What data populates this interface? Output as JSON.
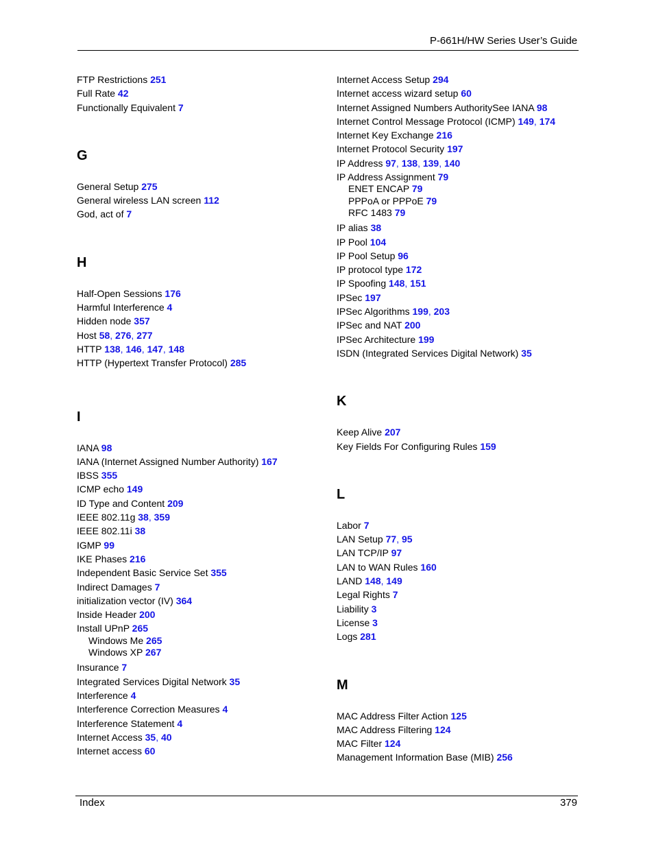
{
  "header": {
    "title": "P-661H/HW Series User’s Guide"
  },
  "footer": {
    "section": "Index",
    "page_number": "379"
  },
  "colors": {
    "link": "#1414e6",
    "text": "#000000"
  },
  "left_column": {
    "f_entries": [
      {
        "term": "FTP Restrictions",
        "pages": [
          "251"
        ]
      },
      {
        "term": "Full Rate",
        "pages": [
          "42"
        ]
      },
      {
        "term": "Functionally Equivalent",
        "pages": [
          "7"
        ]
      }
    ],
    "g": {
      "letter": "G",
      "entries": [
        {
          "term": "General Setup",
          "pages": [
            "275"
          ]
        },
        {
          "term": "General wireless LAN screen",
          "pages": [
            "112"
          ]
        },
        {
          "term": "God, act of",
          "pages": [
            "7"
          ]
        }
      ]
    },
    "h": {
      "letter": "H",
      "entries": [
        {
          "term": "Half-Open Sessions",
          "pages": [
            "176"
          ]
        },
        {
          "term": "Harmful Interference",
          "pages": [
            "4"
          ]
        },
        {
          "term": "Hidden node",
          "pages": [
            "357"
          ]
        },
        {
          "term": "Host",
          "pages": [
            "58",
            "276",
            "277"
          ]
        },
        {
          "term": "HTTP",
          "pages": [
            "138",
            "146",
            "147",
            "148"
          ]
        },
        {
          "term": "HTTP (Hypertext Transfer Protocol)",
          "pages": [
            "285"
          ]
        }
      ]
    },
    "i": {
      "letter": "I",
      "entries": [
        {
          "term": "IANA",
          "pages": [
            "98"
          ]
        },
        {
          "term": "IANA (Internet Assigned Number Authority)",
          "pages": [
            "167"
          ]
        },
        {
          "term": "IBSS",
          "pages": [
            "355"
          ]
        },
        {
          "term": "ICMP echo",
          "pages": [
            "149"
          ]
        },
        {
          "term": "ID Type and Content",
          "pages": [
            "209"
          ]
        },
        {
          "term": "IEEE 802.11g",
          "pages": [
            "38",
            "359"
          ]
        },
        {
          "term": "IEEE 802.11i",
          "pages": [
            "38"
          ]
        },
        {
          "term": "IGMP",
          "pages": [
            "99"
          ]
        },
        {
          "term": "IKE Phases",
          "pages": [
            "216"
          ]
        },
        {
          "term": "Independent Basic Service Set",
          "pages": [
            "355"
          ]
        },
        {
          "term": "Indirect Damages",
          "pages": [
            "7"
          ]
        },
        {
          "term": "initialization vector (IV)",
          "pages": [
            "364"
          ]
        },
        {
          "term": "Inside Header",
          "pages": [
            "200"
          ]
        },
        {
          "term": "Install UPnP",
          "pages": [
            "265"
          ],
          "sub": [
            {
              "term": "Windows Me",
              "pages": [
                "265"
              ]
            },
            {
              "term": "Windows XP",
              "pages": [
                "267"
              ]
            }
          ]
        },
        {
          "term": "Insurance",
          "pages": [
            "7"
          ]
        },
        {
          "term": "Integrated Services Digital Network",
          "pages": [
            "35"
          ]
        },
        {
          "term": "Interference",
          "pages": [
            "4"
          ]
        },
        {
          "term": "Interference Correction Measures",
          "pages": [
            "4"
          ]
        },
        {
          "term": "Interference Statement",
          "pages": [
            "4"
          ]
        },
        {
          "term": "Internet Access",
          "pages": [
            "35",
            "40"
          ]
        },
        {
          "term": "Internet access",
          "pages": [
            "60"
          ]
        }
      ]
    }
  },
  "right_column": {
    "i_entries": [
      {
        "term": "Internet Access Setup",
        "pages": [
          "294"
        ]
      },
      {
        "term": "Internet access wizard setup",
        "pages": [
          "60"
        ]
      },
      {
        "term": "Internet Assigned Numbers AuthoritySee IANA",
        "pages": [
          "98"
        ]
      },
      {
        "term": "Internet Control Message Protocol (ICMP)",
        "pages": [
          "149",
          "174"
        ]
      },
      {
        "term": "Internet Key Exchange",
        "pages": [
          "216"
        ]
      },
      {
        "term": "Internet Protocol Security",
        "pages": [
          "197"
        ]
      },
      {
        "term": "IP Address",
        "pages": [
          "97",
          "138",
          "139",
          "140"
        ]
      },
      {
        "term": "IP Address Assignment",
        "pages": [
          "79"
        ],
        "sub": [
          {
            "term": "ENET ENCAP",
            "pages": [
              "79"
            ]
          },
          {
            "term": "PPPoA or PPPoE",
            "pages": [
              "79"
            ]
          },
          {
            "term": "RFC 1483",
            "pages": [
              "79"
            ]
          }
        ]
      },
      {
        "term": "IP alias",
        "pages": [
          "38"
        ]
      },
      {
        "term": "IP Pool",
        "pages": [
          "104"
        ]
      },
      {
        "term": "IP Pool Setup",
        "pages": [
          "96"
        ]
      },
      {
        "term": "IP protocol type",
        "pages": [
          "172"
        ]
      },
      {
        "term": "IP Spoofing",
        "pages": [
          "148",
          "151"
        ]
      },
      {
        "term": "IPSec",
        "pages": [
          "197"
        ]
      },
      {
        "term": "IPSec Algorithms",
        "pages": [
          "199",
          "203"
        ]
      },
      {
        "term": "IPSec and NAT",
        "pages": [
          "200"
        ]
      },
      {
        "term": "IPSec Architecture",
        "pages": [
          "199"
        ]
      },
      {
        "term": "ISDN (Integrated Services Digital Network)",
        "pages": [
          "35"
        ]
      }
    ],
    "k": {
      "letter": "K",
      "entries": [
        {
          "term": "Keep Alive",
          "pages": [
            "207"
          ]
        },
        {
          "term": "Key Fields For Configuring Rules",
          "pages": [
            "159"
          ]
        }
      ]
    },
    "l": {
      "letter": "L",
      "entries": [
        {
          "term": "Labor",
          "pages": [
            "7"
          ]
        },
        {
          "term": "LAN Setup",
          "pages": [
            "77",
            "95"
          ]
        },
        {
          "term": "LAN TCP/IP",
          "pages": [
            "97"
          ]
        },
        {
          "term": "LAN to WAN Rules",
          "pages": [
            "160"
          ]
        },
        {
          "term": "LAND",
          "pages": [
            "148",
            "149"
          ]
        },
        {
          "term": "Legal Rights",
          "pages": [
            "7"
          ]
        },
        {
          "term": "Liability",
          "pages": [
            "3"
          ]
        },
        {
          "term": "License",
          "pages": [
            "3"
          ]
        },
        {
          "term": "Logs",
          "pages": [
            "281"
          ]
        }
      ]
    },
    "m": {
      "letter": "M",
      "entries": [
        {
          "term": "MAC Address Filter Action",
          "pages": [
            "125"
          ]
        },
        {
          "term": "MAC Address Filtering",
          "pages": [
            "124"
          ]
        },
        {
          "term": "MAC Filter",
          "pages": [
            "124"
          ]
        },
        {
          "term": "Management Information Base (MIB)",
          "pages": [
            "256"
          ]
        }
      ]
    }
  }
}
